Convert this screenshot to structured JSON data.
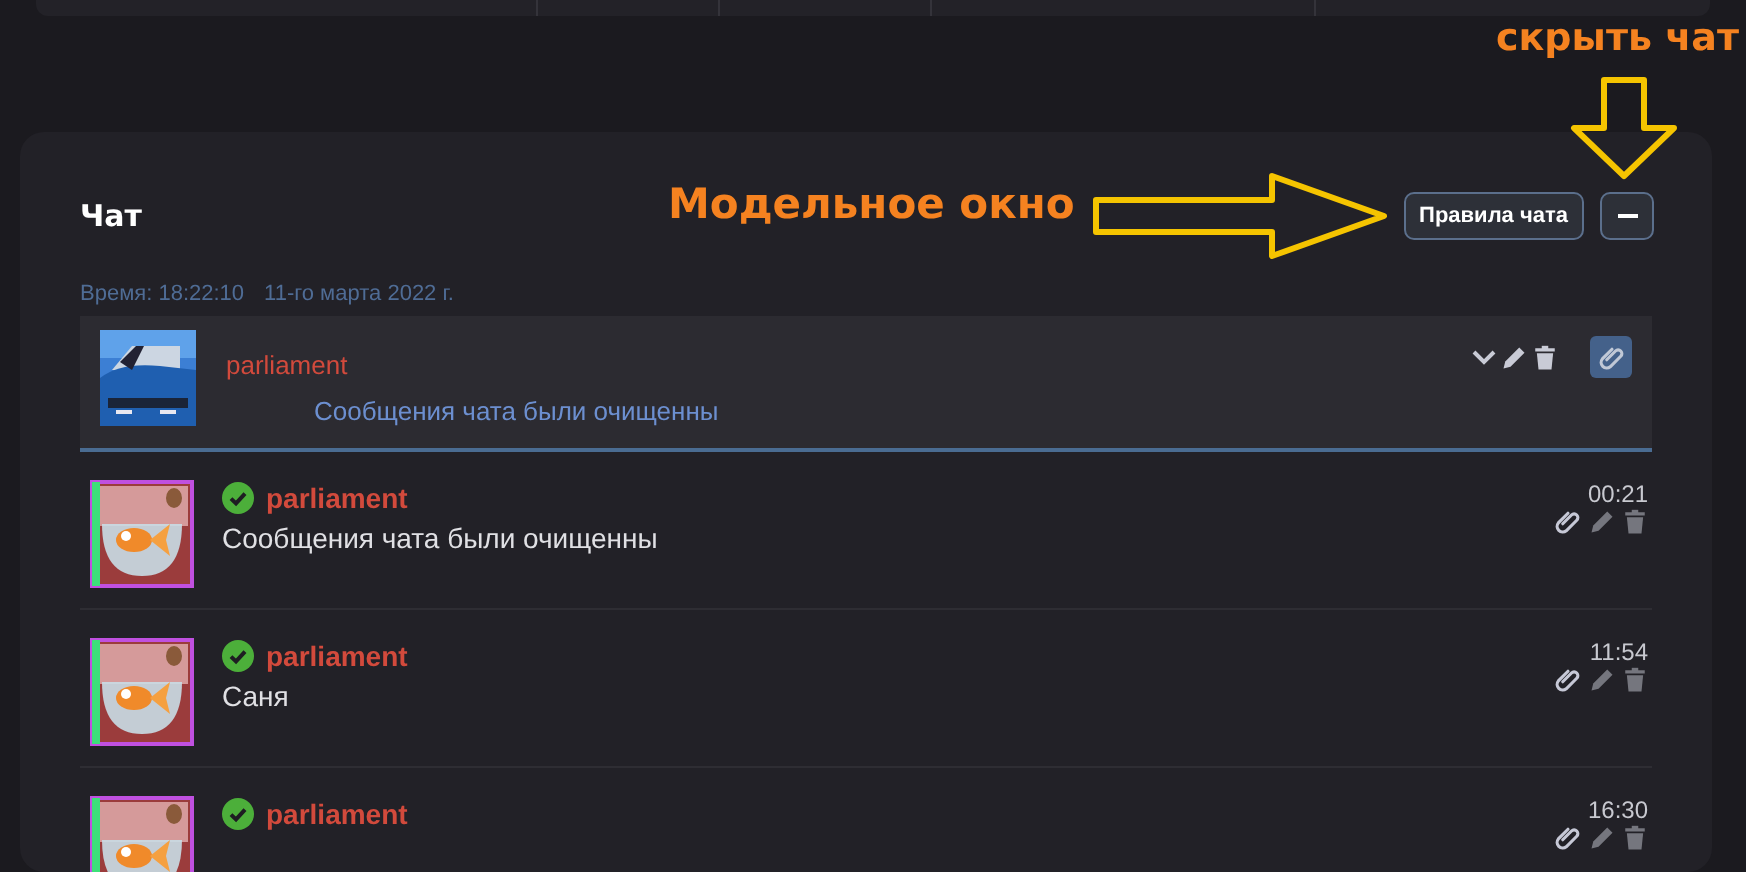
{
  "chat": {
    "title": "Чат",
    "rules_button": "Правила чата",
    "date_line": {
      "time": "Время: 18:22:10",
      "date": "11-го марта 2022 г."
    },
    "pinned": {
      "user": "parliament",
      "text": "Сообщения чата были очищенны"
    },
    "messages": [
      {
        "user": "parliament",
        "verified": true,
        "text": "Сообщения чата были очищенны",
        "time": "00:21"
      },
      {
        "user": "parliament",
        "verified": true,
        "text": "Саня",
        "time": "11:54"
      },
      {
        "user": "parliament",
        "verified": true,
        "time": "16:30"
      }
    ]
  },
  "annotations": [
    {
      "kind": "arrow-right",
      "text": "Модельное окно"
    },
    {
      "kind": "arrow-down",
      "text": "скрыть чат"
    }
  ]
}
